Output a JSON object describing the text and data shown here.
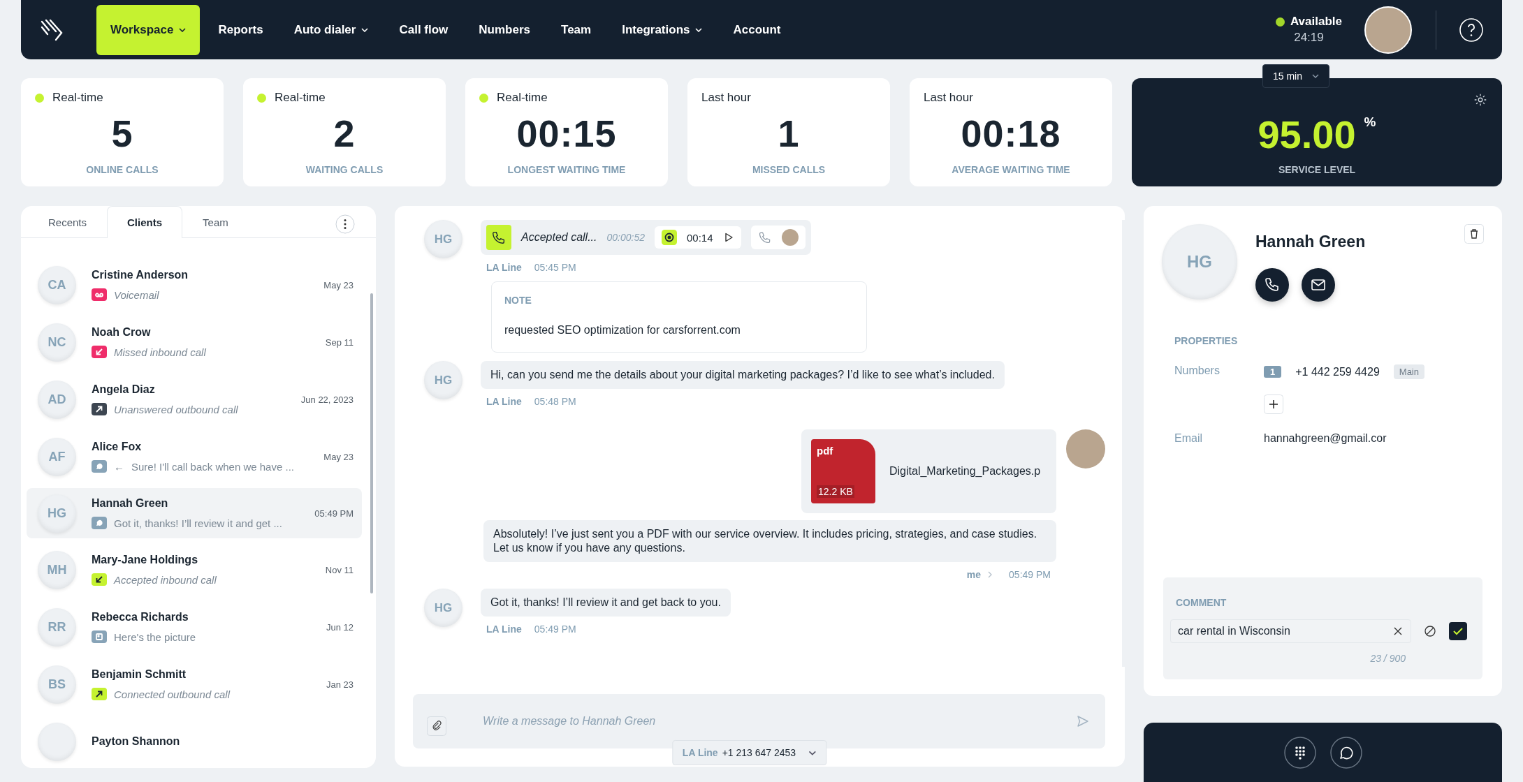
{
  "nav": {
    "items": [
      {
        "label": "Workspace",
        "selected": true,
        "dropdown": true
      },
      {
        "label": "Reports",
        "selected": false,
        "dropdown": false
      },
      {
        "label": "Auto dialer",
        "selected": false,
        "dropdown": true
      },
      {
        "label": "Call flow",
        "selected": false,
        "dropdown": false
      },
      {
        "label": "Numbers",
        "selected": false,
        "dropdown": false
      },
      {
        "label": "Team",
        "selected": false,
        "dropdown": false
      },
      {
        "label": "Integrations",
        "selected": false,
        "dropdown": true
      },
      {
        "label": "Account",
        "selected": false,
        "dropdown": false
      }
    ],
    "status": {
      "label": "Available",
      "color": "#a3d62a",
      "timer": "24:19"
    }
  },
  "stats": [
    {
      "period": "Real-time",
      "live": true,
      "value": "5",
      "caption": "ONLINE CALLS"
    },
    {
      "period": "Real-time",
      "live": true,
      "value": "2",
      "caption": "WAITING CALLS"
    },
    {
      "period": "Real-time",
      "live": true,
      "value": "00:15",
      "caption": "LONGEST WAITING TIME"
    },
    {
      "period": "Last hour",
      "live": false,
      "value": "1",
      "caption": "MISSED CALLS"
    },
    {
      "period": "Last hour",
      "live": false,
      "value": "00:18",
      "caption": "AVERAGE WAITING TIME"
    }
  ],
  "service_level": {
    "interval": "15 min",
    "value": "95.00",
    "unit": "%",
    "caption": "SERVICE LEVEL"
  },
  "contacts": {
    "tabs": [
      {
        "label": "Recents",
        "selected": false
      },
      {
        "label": "Clients",
        "selected": true
      },
      {
        "label": "Team",
        "selected": false
      }
    ],
    "items": [
      {
        "initials": "CA",
        "name": "Cristine Anderson",
        "kind": "voicemail",
        "preview": "Voicemail",
        "date": "May 23",
        "selected": false
      },
      {
        "initials": "NC",
        "name": "Noah Crow",
        "kind": "missed",
        "preview": "Missed inbound call",
        "date": "Sep 11",
        "selected": false
      },
      {
        "initials": "AD",
        "name": "Angela Diaz",
        "kind": "unanswered",
        "preview": "Unanswered outbound call",
        "date": "Jun 22, 2023",
        "selected": false
      },
      {
        "initials": "AF",
        "name": "Alice Fox",
        "kind": "message",
        "prefix": "←",
        "preview": "Sure! I'll call back when we have ...",
        "date": "May 23",
        "selected": false
      },
      {
        "initials": "HG",
        "name": "Hannah Green",
        "kind": "message",
        "preview": "Got it, thanks! I’ll review it and get ...",
        "date": "05:49 PM",
        "selected": true
      },
      {
        "initials": "MH",
        "name": "Mary-Jane Holdings",
        "kind": "accepted",
        "preview": "Accepted inbound call",
        "date": "Nov 11",
        "selected": false
      },
      {
        "initials": "RR",
        "name": "Rebecca Richards",
        "kind": "image",
        "preview": "Here's the picture",
        "date": "Jun 12",
        "selected": false
      },
      {
        "initials": "BS",
        "name": "Benjamin Schmitt",
        "kind": "connected",
        "preview": "Connected outbound call",
        "date": "Jan 23",
        "selected": false
      },
      {
        "name": "Payton Shannon",
        "selected": false
      }
    ]
  },
  "chat": {
    "messages": [
      {
        "kind": "call",
        "avatar": "HG",
        "title": "Accepted call...",
        "duration": "00:00:52",
        "recording": "00:14",
        "line": "LA Line",
        "time": "05:45 PM"
      },
      {
        "kind": "note",
        "label": "NOTE",
        "text": "requested SEO optimization for carsforrent.com"
      },
      {
        "kind": "text",
        "avatar": "HG",
        "text": "Hi, can you send me the details about your digital marketing packages? I’d like to see what’s included.",
        "line": "LA Line",
        "time": "05:48 PM"
      },
      {
        "kind": "file",
        "file_type": "pdf",
        "size": "12.2 KB",
        "file_name": "Digital_Marketing_Packages.p",
        "text": "Absolutely! I’ve just sent you a PDF with our service overview. It includes pricing, strategies, and case studies. Let us know if you have any questions.",
        "sender": "me",
        "time": "05:49 PM"
      },
      {
        "kind": "text",
        "avatar": "HG",
        "text": "Got it, thanks! I’ll review it and get back to you.",
        "line": "LA Line",
        "time": "05:49 PM"
      }
    ],
    "composer": {
      "placeholder": "Write a message to Hannah Green",
      "line": "LA Line",
      "number": "+1 213 647 2453"
    }
  },
  "profile": {
    "initials": "HG",
    "name": "Hannah Green",
    "properties_title": "PROPERTIES",
    "numbers_label": "Numbers",
    "numbers": [
      {
        "index": "1",
        "number": "+1 442 259 4429",
        "tag": "Main"
      }
    ],
    "email_label": "Email",
    "email": "hannahgreen@gmail.cor",
    "comment": {
      "label": "COMMENT",
      "value": "car rental in Wisconsin",
      "counter": "23 / 900"
    }
  }
}
